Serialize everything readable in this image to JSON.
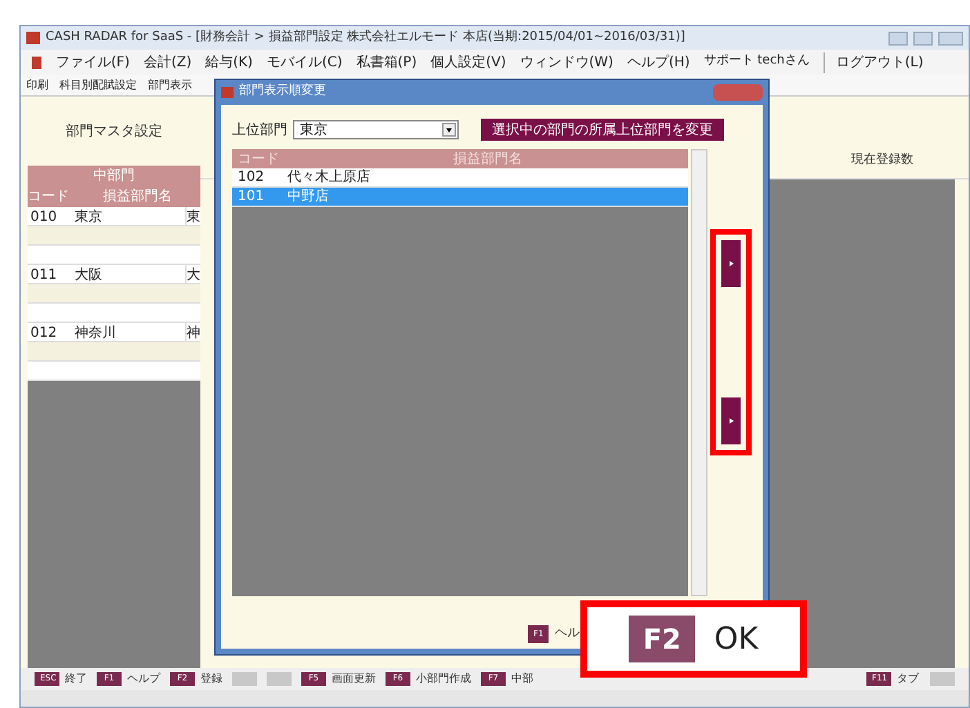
{
  "window": {
    "title": "CASH RADAR for SaaS - [財務会計 > 損益部門設定 株式会社エルモード 本店(当期:2015/04/01~2016/03/31)]"
  },
  "menu": [
    "ファイル(F)",
    "会計(Z)",
    "給与(K)",
    "モバイル(C)",
    "私書箱(P)",
    "個人設定(V)",
    "ウィンドウ(W)",
    "ヘルプ(H)"
  ],
  "user": "サポート techさん",
  "logout": "ログアウト(L)",
  "toolbar": [
    "印刷",
    "科目別配賦設定",
    "部門表示"
  ],
  "panel": {
    "title": "部門マスタ設定",
    "group": "中部門",
    "columns": [
      "コード",
      "損益部門名"
    ],
    "rows": [
      {
        "code": "010",
        "name": "東京",
        "column_3": "東"
      },
      {
        "code": "011",
        "name": "大阪",
        "column_3": "大"
      },
      {
        "code": "012",
        "name": "神奈川",
        "column_3": "神"
      }
    ],
    "count_label": "現在登録数"
  },
  "dialog": {
    "title": "部門表示順変更",
    "parent_label": "上位部門",
    "parent_value": "東京",
    "change_button": "選択中の部門の所属上位部門を変更",
    "columns": [
      "コード",
      "損益部門名"
    ],
    "rows": [
      {
        "code": "102",
        "name": "代々木上原店",
        "selected": false
      },
      {
        "code": "101",
        "name": "中野店",
        "selected": true
      }
    ],
    "help_key": "F1",
    "help_label": "ヘル"
  },
  "ok_callout": {
    "key": "F2",
    "label": "OK"
  },
  "function_keys": [
    {
      "key": "ESC",
      "label": "終了",
      "disabled": false
    },
    {
      "key": "F1",
      "label": "ヘルプ",
      "disabled": false
    },
    {
      "key": "F2",
      "label": "登録",
      "disabled": false
    },
    {
      "disabled": true
    },
    {
      "disabled": true
    },
    {
      "key": "F5",
      "label": "画面更新",
      "disabled": false
    },
    {
      "key": "F6",
      "label": "小部門作成",
      "disabled": false
    },
    {
      "key": "F7",
      "label": "中部",
      "disabled": false
    }
  ],
  "function_keys_right": [
    {
      "key": "F11",
      "label": "タブ",
      "disabled": false
    },
    {
      "disabled": true
    }
  ]
}
